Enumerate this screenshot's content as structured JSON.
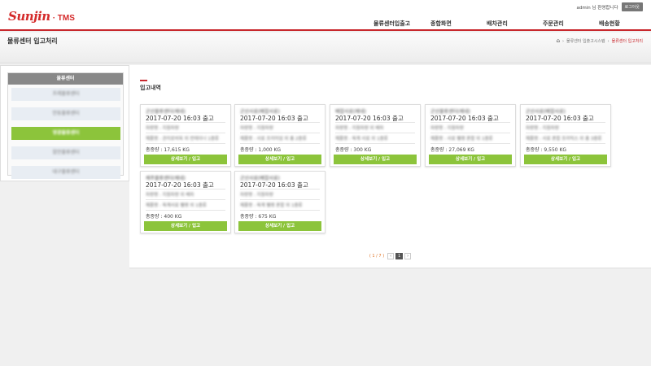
{
  "header": {
    "logo_brand": "Sunjin",
    "logo_sub": "· TMS",
    "user_text": "admin 님 환영합니다",
    "logout_label": "로그아웃"
  },
  "nav": {
    "items": [
      "물류센터입출고",
      "종합화면",
      "배차관리",
      "주문관리",
      "배송현황"
    ]
  },
  "titlebar": {
    "title": "물류센터 입고처리",
    "breadcrumb_home_icon": "home-icon",
    "breadcrumb_parent": "물류센터 입출고시스템",
    "breadcrumb_sep": "›",
    "breadcrumb_current": "물류센터 입고처리"
  },
  "sidebar": {
    "title": "물류센터",
    "items": [
      {
        "label": "프레물류센터",
        "active": false
      },
      {
        "label": "안동물류센터",
        "active": false
      },
      {
        "label": "영광물류센터",
        "active": true
      },
      {
        "label": "함안물류센터",
        "active": false
      },
      {
        "label": "대구물류센터",
        "active": false
      }
    ]
  },
  "content": {
    "section_title": "입고내역",
    "button_label": "상세보기 / 입고",
    "cards": [
      {
        "company": "군산물류센터(제네)",
        "datetime": "2017-07-20 16:03 출고",
        "line1": "차량명 : 지원차량",
        "line2": "제품명 : 관리로비옥 외 컨테이너 1종류",
        "weight": "총중량 : 17,615 KG"
      },
      {
        "company": "군산사료(배합사료)",
        "datetime": "2017-07-20 16:03 출고",
        "line1": "차량명 : 지원차량",
        "line2": "제품명 : 사료 프리미엄 외 총 2종류",
        "weight": "총중량 : 1,000 KG"
      },
      {
        "company": "배합사료(제네)",
        "datetime": "2017-07-20 16:03 출고",
        "line1": "차량명 : 지원차량 외 배차",
        "line2": "제품명 : 육계 사료 외 1종류",
        "weight": "총중량 : 300 KG"
      },
      {
        "company": "군산물류센터(제네)",
        "datetime": "2017-07-20 16:03 출고",
        "line1": "차량명 : 지원차량",
        "line2": "제품명 : 사료 펠렛 혼합 외 1종류",
        "weight": "총중량 : 27,069 KG"
      },
      {
        "company": "군산사료(배합사료)",
        "datetime": "2017-07-20 16:03 출고",
        "line1": "차량명 : 지원차량",
        "line2": "제품명 : 사료 혼합 프리믹스 외 총 3종류",
        "weight": "총중량 : 9,550 KG"
      },
      {
        "company": "제주물류센터(제네)",
        "datetime": "2017-07-20 16:03 출고",
        "line1": "차량명 : 지원차량 외 배차",
        "line2": "제품명 : 육계사료 펠렛 외 1종류",
        "weight": "총중량 : 400 KG"
      },
      {
        "company": "군산사료(배합사료)",
        "datetime": "2017-07-20 16:03 출고",
        "line1": "차량명 : 지원차량",
        "line2": "제품명 : 육계 펠렛 혼합 외 1종류",
        "weight": "총중량 : 675 KG"
      }
    ]
  },
  "pager": {
    "info": "( 1 / 7 )",
    "prev_label": "‹",
    "page": "1",
    "next_label": "›"
  },
  "colors": {
    "accent_red": "#c8282d",
    "button_green": "#8cc43b"
  }
}
